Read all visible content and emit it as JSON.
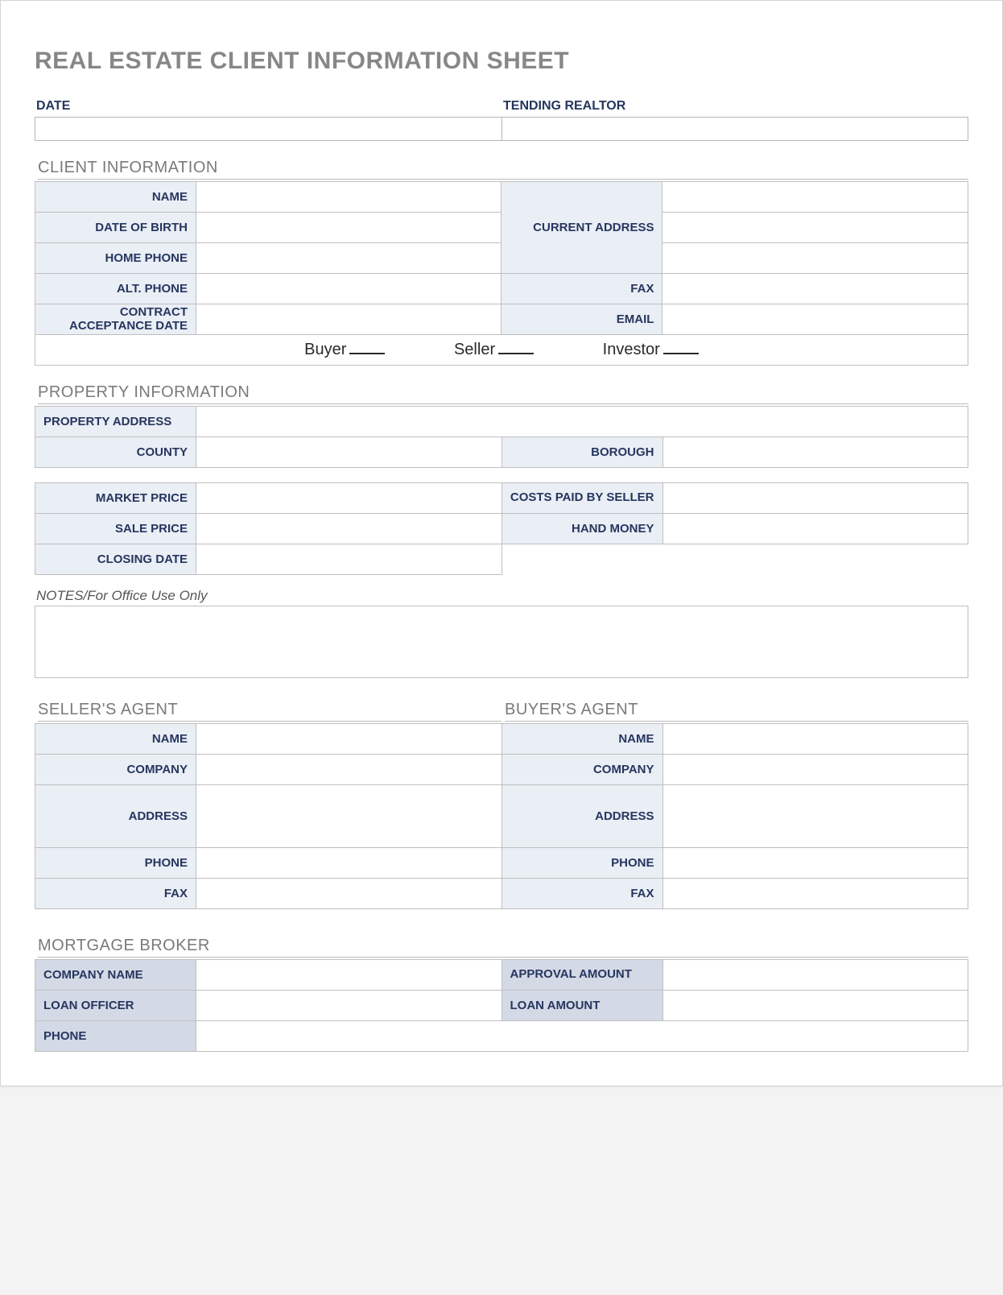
{
  "title": "REAL ESTATE CLIENT INFORMATION SHEET",
  "top": {
    "date_label": "DATE",
    "realtor_label": "TENDING REALTOR",
    "date_value": "",
    "realtor_value": ""
  },
  "client_info": {
    "heading": "CLIENT INFORMATION",
    "labels": {
      "name": "NAME",
      "dob": "DATE OF BIRTH",
      "home_phone": "HOME PHONE",
      "alt_phone": "ALT. PHONE",
      "contract_date": "CONTRACT ACCEPTANCE DATE",
      "current_address": "CURRENT ADDRESS",
      "fax": "FAX",
      "email": "EMAIL"
    },
    "values": {
      "name": "",
      "dob": "",
      "home_phone": "",
      "alt_phone": "",
      "contract_date": "",
      "current_address_1": "",
      "current_address_2": "",
      "current_address_3": "",
      "fax": "",
      "email": ""
    },
    "types": {
      "buyer": "Buyer",
      "seller": "Seller",
      "investor": "Investor"
    }
  },
  "property_info": {
    "heading": "PROPERTY INFORMATION",
    "labels": {
      "address": "PROPERTY ADDRESS",
      "county": "COUNTY",
      "borough": "BOROUGH",
      "market_price": "MARKET PRICE",
      "costs_paid": "COSTS PAID BY SELLER",
      "sale_price": "SALE PRICE",
      "hand_money": "HAND MONEY",
      "closing_date": "CLOSING DATE"
    },
    "values": {
      "address": "",
      "county": "",
      "borough": "",
      "market_price": "",
      "costs_paid": "",
      "sale_price": "",
      "hand_money": "",
      "closing_date": ""
    }
  },
  "notes": {
    "label": "NOTES/For Office Use Only",
    "value": ""
  },
  "seller_agent": {
    "heading": "SELLER'S AGENT",
    "labels": {
      "name": "NAME",
      "company": "COMPANY",
      "address": "ADDRESS",
      "phone": "PHONE",
      "fax": "FAX"
    },
    "values": {
      "name": "",
      "company": "",
      "address": "",
      "phone": "",
      "fax": ""
    }
  },
  "buyer_agent": {
    "heading": "BUYER'S AGENT",
    "labels": {
      "name": "NAME",
      "company": "COMPANY",
      "address": "ADDRESS",
      "phone": "PHONE",
      "fax": "FAX"
    },
    "values": {
      "name": "",
      "company": "",
      "address": "",
      "phone": "",
      "fax": ""
    }
  },
  "broker": {
    "heading": "MORTGAGE BROKER",
    "labels": {
      "company_name": "COMPANY NAME",
      "approval_amount": "APPROVAL AMOUNT",
      "loan_officer": "LOAN OFFICER",
      "loan_amount": "LOAN AMOUNT",
      "phone": "PHONE"
    },
    "values": {
      "company_name": "",
      "approval_amount": "",
      "loan_officer": "",
      "loan_amount": "",
      "phone": ""
    }
  }
}
